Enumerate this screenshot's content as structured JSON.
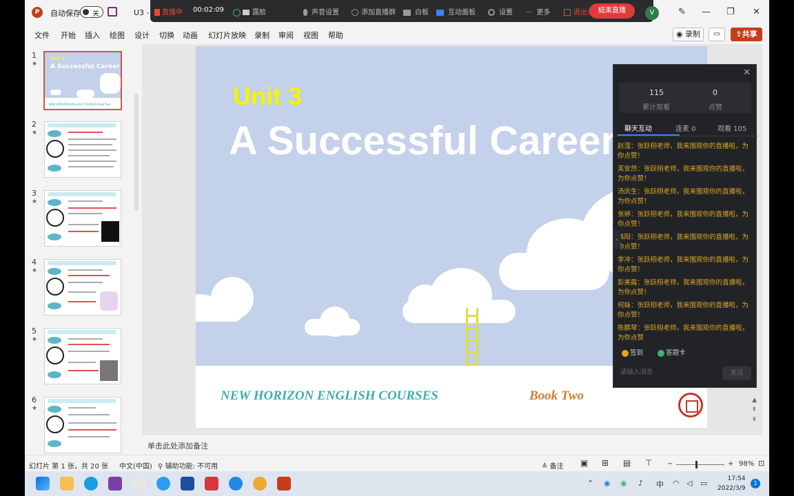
{
  "titlebar": {
    "app_icon": "P",
    "autosave_label": "自动保存",
    "autosave_state": "关",
    "doc_name": "U3 - 2"
  },
  "livebar": {
    "status": "直播中",
    "elapsed": "00:02:09",
    "items": [
      "露脸",
      "声音设置",
      "添加直播群",
      "白板",
      "互动面板",
      "设置",
      "更多",
      "退出共享"
    ],
    "end_label": "结束直播"
  },
  "user_initial": "V",
  "menu": [
    "文件",
    "开始",
    "插入",
    "绘图",
    "设计",
    "切换",
    "动画",
    "幻灯片放映",
    "录制",
    "审阅",
    "视图",
    "帮助"
  ],
  "record_label": "录制",
  "share_label": "共享",
  "thumbnails": [
    {
      "num": "1",
      "star": "★",
      "unit": "Unit 3",
      "title": "A Successful Career",
      "foot": "NEW HORIZON ENGLISH COURSES   Book Two"
    },
    {
      "num": "2",
      "star": "★"
    },
    {
      "num": "3",
      "star": "★"
    },
    {
      "num": "4",
      "star": "★"
    },
    {
      "num": "5",
      "star": "★"
    },
    {
      "num": "6",
      "star": "★"
    }
  ],
  "slide": {
    "unit": "Unit 3",
    "title": "A Successful Career",
    "brand": "NEW HORIZON ENGLISH COURSES",
    "book": "Book Two"
  },
  "notes_placeholder": "单击此处添加备注",
  "status": {
    "slide_info": "幻灯片 第 1 张，共 20 张",
    "language": "中文(中国)",
    "accessibility": "辅助功能: 不可用",
    "notes": "备注",
    "zoom": "98%"
  },
  "panel": {
    "stats": [
      {
        "value": "115",
        "label": "累计观看"
      },
      {
        "value": "0",
        "label": "点赞"
      }
    ],
    "tabs": [
      "聊天互动",
      "连麦 0",
      "观看 105"
    ],
    "messages": [
      "赵滢：张跃栩老师，我来围观你的直播啦，为你点赞！",
      "芙安然：张跃栩老师，我来围观你的直播啦，为你点赞！",
      "汤庆生：张跃栩老师，我来围观你的直播啦，为你点赞！",
      "张婷：张跃栩老师，我来围观你的直播啦，为你点赞！",
      "韩阳：张跃栩老师，我来围观你的直播啦，为你点赞！",
      "李冲：张跃栩老师，我来围观你的直播啦，为你点赞！",
      "彭美霞：张跃栩老师，我来围观你的直播啦，为你点赞！",
      "何妹：张跃栩老师，我来围观你的直播啦，为你点赞！",
      "陈鹏琴：张跃栩老师，我来围观你的直播啦，为你点赞"
    ],
    "signin_label": "签到",
    "answer_label": "答题卡",
    "input_placeholder": "请输入消息",
    "send_label": "发送"
  },
  "clock": {
    "time": "17:54",
    "date": "2022/3/9"
  },
  "tray_lang": "中",
  "notif_count": "1"
}
